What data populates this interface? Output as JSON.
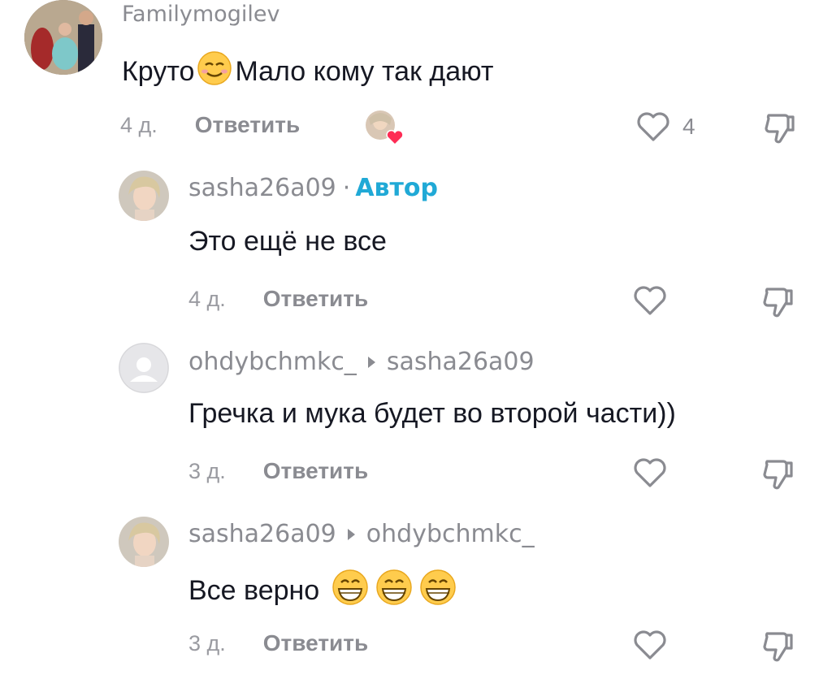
{
  "comments": [
    {
      "username": "Familymogilev",
      "text_before": "Круто",
      "text_after": "Мало кому так дают",
      "time": "4 д.",
      "reply_label": "Ответить",
      "likes": "4"
    },
    {
      "username": "sasha26a09",
      "author_label": "Автор",
      "text": "Это ещё не все",
      "time": "4 д.",
      "reply_label": "Ответить"
    },
    {
      "username": "ohdybchmkc_",
      "reply_to": "sasha26a09",
      "text": "Гречка и мука будет во второй части))",
      "time": "3 д.",
      "reply_label": "Ответить"
    },
    {
      "username": "sasha26a09",
      "reply_to": "ohdybchmkc_",
      "text": "Все верно",
      "time": "3 д.",
      "reply_label": "Ответить"
    }
  ],
  "colors": {
    "author": "#20a9d6",
    "muted": "#8a8b91",
    "heart_badge": "#fe2c55"
  }
}
